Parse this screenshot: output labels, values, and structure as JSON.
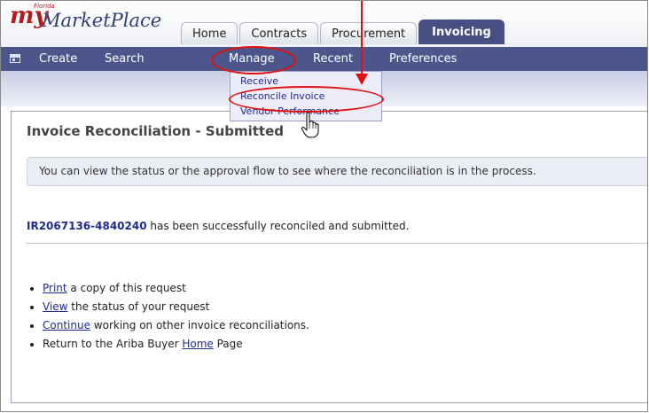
{
  "logo": {
    "prefix": "my",
    "name": "MarketPlace",
    "state": "Florida"
  },
  "tabs": [
    {
      "label": "Home",
      "active": false
    },
    {
      "label": "Contracts",
      "active": false
    },
    {
      "label": "Procurement",
      "active": false
    },
    {
      "label": "Invoicing",
      "active": true
    }
  ],
  "nav": {
    "icon": "layout-icon",
    "items": [
      "Create",
      "Search",
      "Manage",
      "Recent",
      "Preferences"
    ]
  },
  "manage_menu": {
    "items": [
      "Receive",
      "Reconcile Invoice",
      "Vendor Performance"
    ]
  },
  "page": {
    "title": "Invoice Reconciliation - Submitted",
    "info": "You can view the status or the approval flow to see where the reconciliation is in the process.",
    "confirmation": {
      "id": "IR2067136-4840240",
      "text": " has been successfully reconciled and submitted."
    },
    "actions": [
      {
        "link": "Print",
        "text": " a copy of this request",
        "prefix": ""
      },
      {
        "link": "View",
        "text": " the status of your request",
        "prefix": ""
      },
      {
        "link": "Continue",
        "text": " working on other invoice reconciliations.",
        "prefix": ""
      },
      {
        "link": "Home",
        "text": " Page",
        "prefix": "Return to the Ariba Buyer "
      }
    ]
  },
  "colors": {
    "nav_bar": "#4d568a",
    "active_tab": "#474f83",
    "link": "#1f2c8c",
    "annotation": "#e01010"
  }
}
